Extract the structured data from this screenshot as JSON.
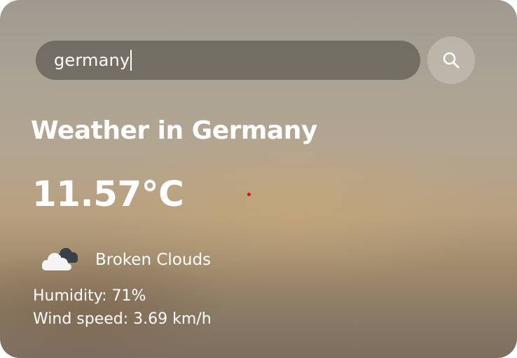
{
  "search": {
    "value": "germany",
    "button_icon": "search-icon"
  },
  "weather": {
    "title": "Weather in Germany",
    "temperature": "11.57°C",
    "condition_icon": "broken-clouds-icon",
    "condition": "Broken Clouds",
    "humidity": "Humidity: 71%",
    "wind": "Wind speed: 3.69 km/h"
  },
  "colors": {
    "text": "#ffffff",
    "search_field": "#5f5a53",
    "cursor_dot": "#e01010"
  }
}
